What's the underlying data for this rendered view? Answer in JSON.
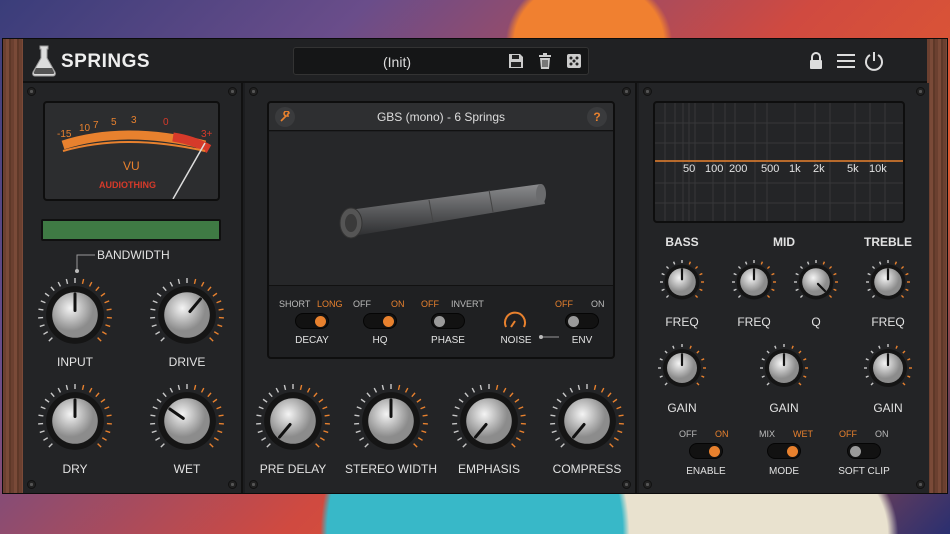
{
  "header": {
    "brand": "SPRINGS",
    "preset": "(Init)"
  },
  "icons": {
    "logo": "flask-icon",
    "save": "save-icon",
    "delete": "trash-icon",
    "random": "dice-icon",
    "lock": "lock-icon",
    "menu": "menu-icon",
    "power": "power-icon"
  },
  "colors": {
    "accent": "#e8812e",
    "vu_red": "#d63a2a",
    "display_green": "#3f7a44",
    "panel": "#232426"
  },
  "vu": {
    "scale": [
      "-15",
      "10",
      "7",
      "5",
      "3",
      "0",
      "3+"
    ],
    "label": "VU",
    "maker": "AUDIOTHING"
  },
  "left": {
    "bandwidth": "BANDWIDTH",
    "input": "INPUT",
    "drive": "DRIVE",
    "dry": "DRY",
    "wet": "WET"
  },
  "center": {
    "tank_title": "GBS (mono) - 6 Springs",
    "help": "?",
    "decay": {
      "off": "SHORT",
      "on": "LONG",
      "label": "DECAY"
    },
    "hq": {
      "off": "OFF",
      "on": "ON",
      "label": "HQ"
    },
    "phase": {
      "off": "OFF",
      "on": "INVERT",
      "label": "PHASE"
    },
    "noise": "NOISE",
    "env": {
      "off": "OFF",
      "on": "ON",
      "label": "ENV"
    },
    "knobs": {
      "predelay": "PRE DELAY",
      "stereo": "STEREO WIDTH",
      "emphasis": "EMPHASIS",
      "compress": "COMPRESS"
    }
  },
  "eq": {
    "freqs": [
      "50",
      "100",
      "200",
      "500",
      "1k",
      "2k",
      "5k",
      "10k"
    ],
    "bass": "BASS",
    "mid": "MID",
    "treble": "TREBLE",
    "freq": "FREQ",
    "q": "Q",
    "gain": "GAIN",
    "enable": {
      "off": "OFF",
      "on": "ON",
      "label": "ENABLE"
    },
    "mode": {
      "off": "MIX",
      "on": "WET",
      "label": "MODE"
    },
    "softclip": {
      "off": "OFF",
      "on": "ON",
      "label": "SOFT CLIP"
    }
  }
}
